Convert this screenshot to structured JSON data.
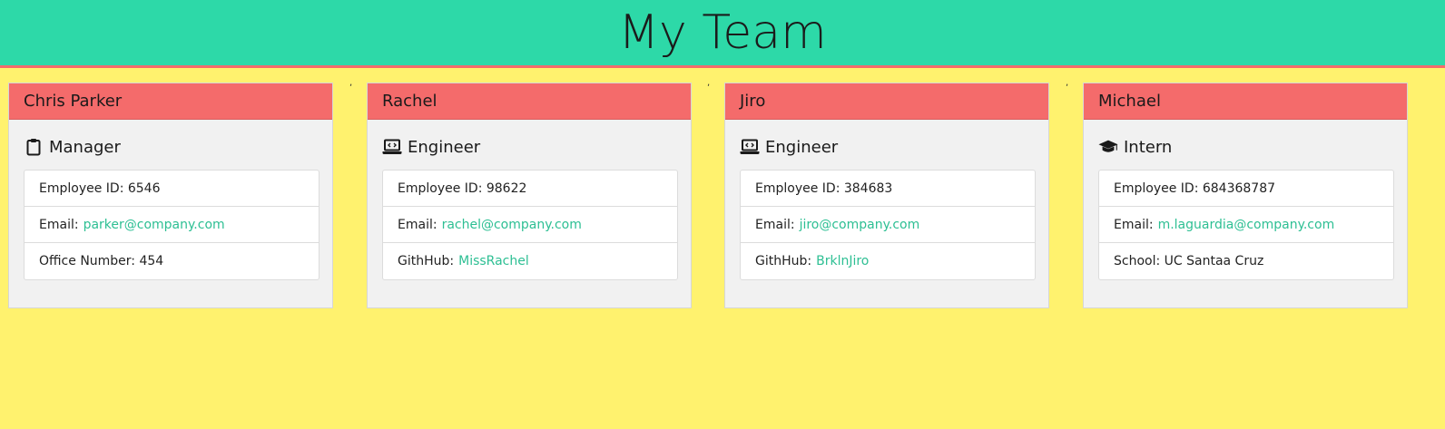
{
  "header": {
    "title": "My Team"
  },
  "separator": ",",
  "colors": {
    "background": "#fff26e",
    "header": "#2dd9a8",
    "card_header": "#f46b6b",
    "link": "#2dbf93"
  },
  "cards": [
    {
      "name": "Chris Parker",
      "role": "Manager",
      "role_icon": "clipboard-icon",
      "id_label": "Employee ID: 6546",
      "email_label": "Email:",
      "email": "parker@company.com",
      "extra_label": "Office Number: 454",
      "extra_link": ""
    },
    {
      "name": "Rachel",
      "role": "Engineer",
      "role_icon": "laptop-code-icon",
      "id_label": "Employee ID: 98622",
      "email_label": "Email:",
      "email": "rachel@company.com",
      "extra_label": "GithHub:",
      "extra_link": "MissRachel"
    },
    {
      "name": "Jiro",
      "role": "Engineer",
      "role_icon": "laptop-code-icon",
      "id_label": "Employee ID: 384683",
      "email_label": "Email:",
      "email": "jiro@company.com",
      "extra_label": "GithHub:",
      "extra_link": "BrklnJiro"
    },
    {
      "name": "Michael",
      "role": "Intern",
      "role_icon": "graduation-cap-icon",
      "id_label": "Employee ID: 684368787",
      "email_label": "Email:",
      "email": "m.laguardia@company.com",
      "extra_label": "School: UC Santaa Cruz",
      "extra_link": ""
    }
  ]
}
